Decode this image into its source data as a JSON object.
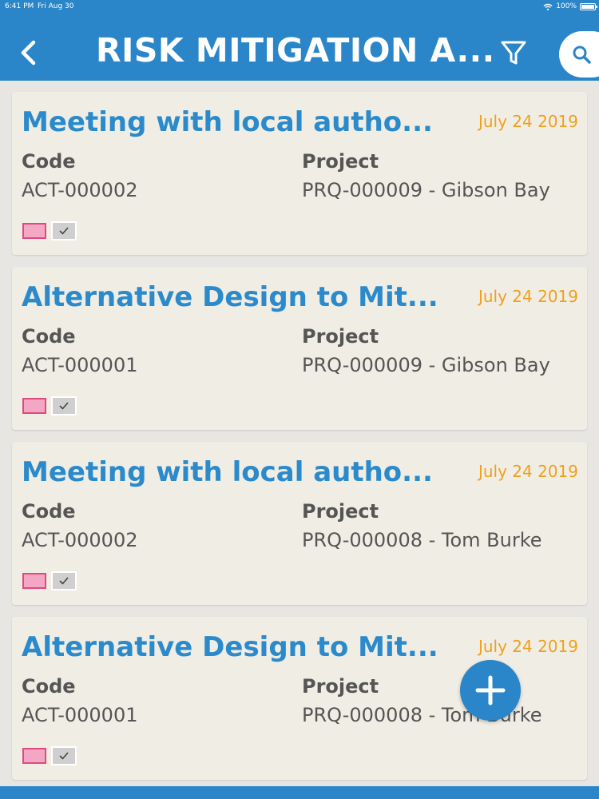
{
  "status_bar": {
    "time": "6:41 PM",
    "date": "Fri Aug 30",
    "battery": "100%"
  },
  "header": {
    "title": "RISK MITIGATION A...",
    "back_icon": "chevron-left-icon",
    "filter_icon": "filter-icon",
    "search_icon": "search-icon"
  },
  "labels": {
    "code": "Code",
    "project": "Project"
  },
  "cards": [
    {
      "title": "Meeting with local autho...",
      "date": "July 24 2019",
      "code": "ACT-000002",
      "project": "PRQ-000009 - Gibson Bay"
    },
    {
      "title": "Alternative Design to Mit...",
      "date": "July 24 2019",
      "code": "ACT-000001",
      "project": "PRQ-000009 - Gibson Bay"
    },
    {
      "title": "Meeting with local autho...",
      "date": "July 24 2019",
      "code": "ACT-000002",
      "project": "PRQ-000008 - Tom Burke"
    },
    {
      "title": "Alternative Design to Mit...",
      "date": "July 24 2019",
      "code": "ACT-000001",
      "project": "PRQ-000008 - Tom Burke"
    }
  ],
  "fab": {
    "icon": "plus-icon"
  },
  "colors": {
    "header": "#2a86c8",
    "title": "#2a8acb",
    "date": "#efa01e",
    "card": "#f0ede4",
    "swatch_fill": "#f4a7c4",
    "swatch_border": "#de4a7d"
  }
}
